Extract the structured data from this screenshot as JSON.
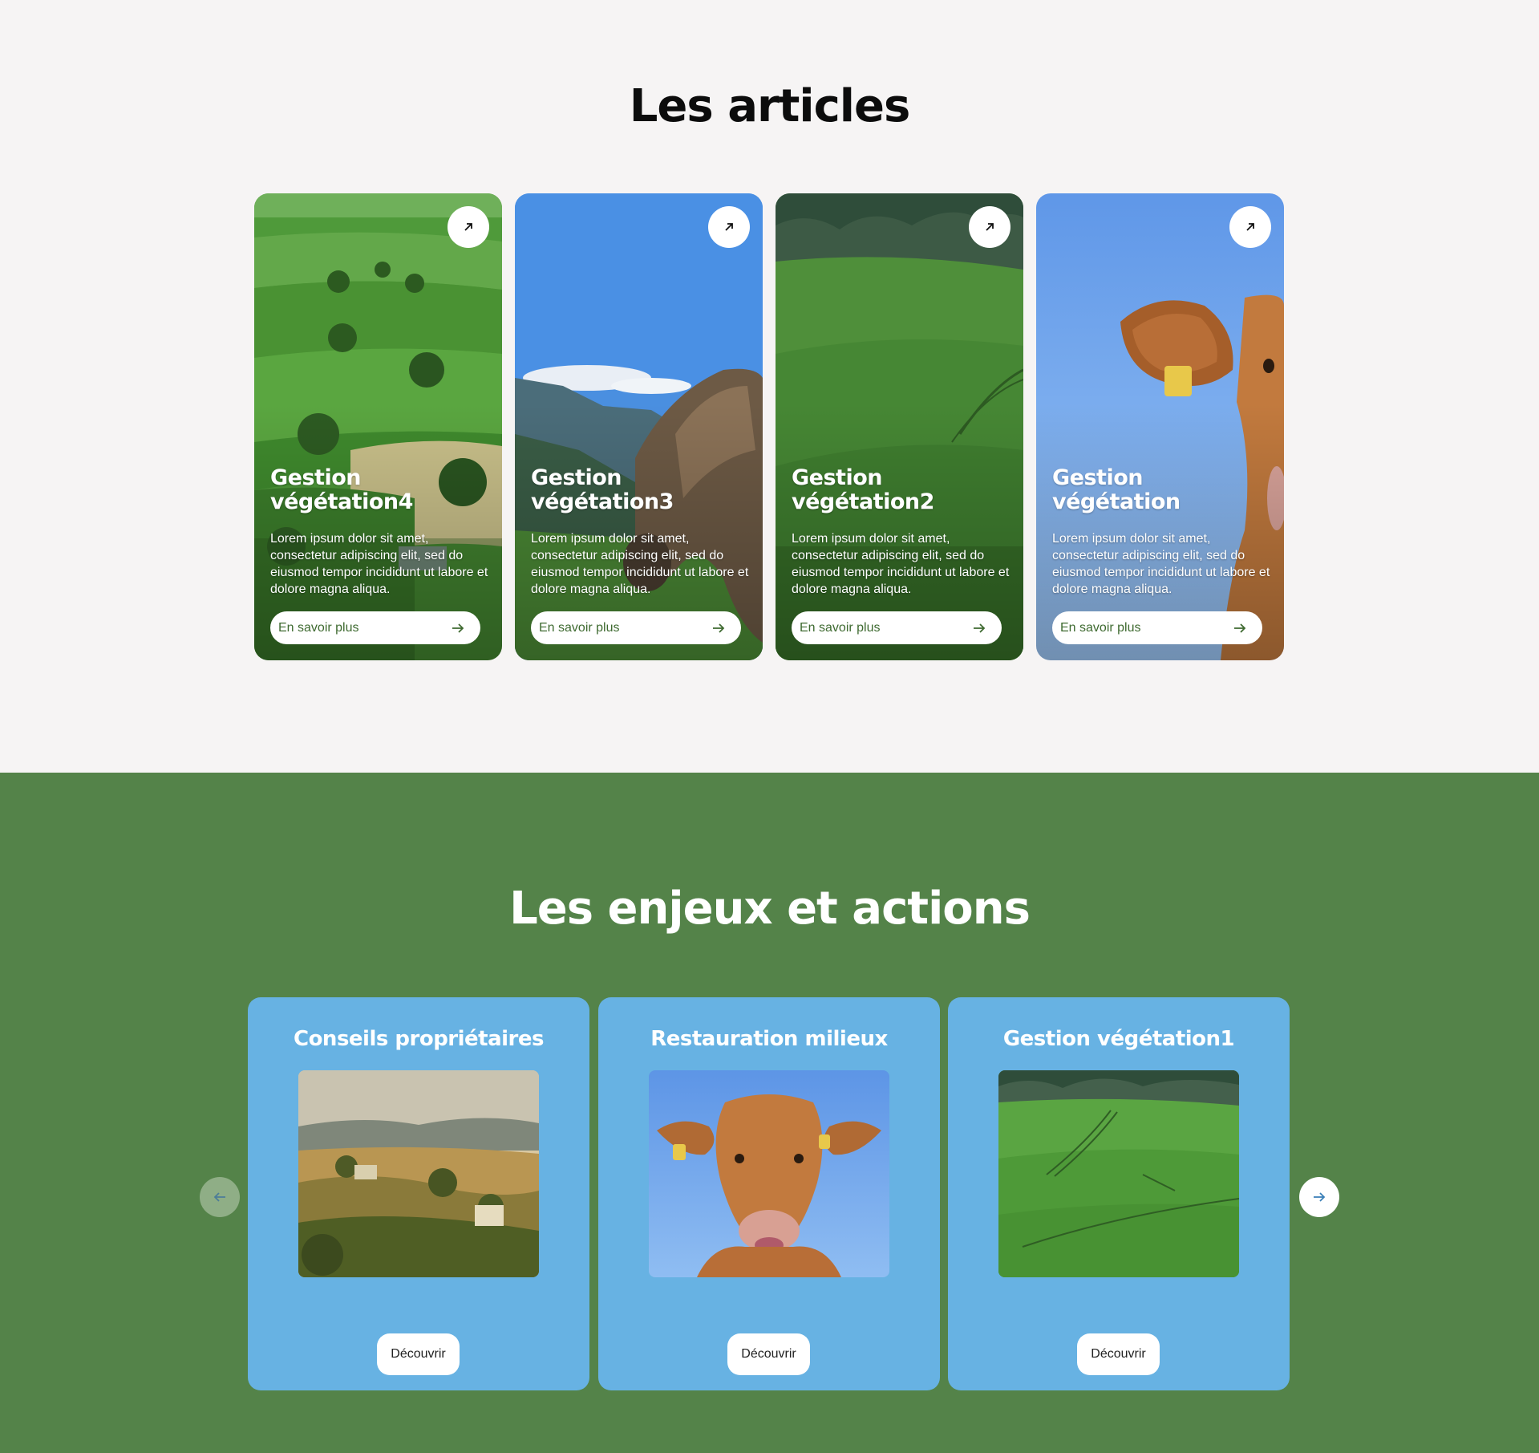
{
  "articles": {
    "heading": "Les articles",
    "cards": [
      {
        "title": "Gestion végétation4",
        "text": "Lorem ipsum dolor sit amet, consectetur adipiscing elit, sed do eiusmod tempor incididunt ut labore et dolore magna aliqua.",
        "button": "En savoir plus",
        "scene": "green-hills-village"
      },
      {
        "title": "Gestion végétation3",
        "text": "Lorem ipsum dolor sit amet, consectetur adipiscing elit, sed do eiusmod tempor incididunt ut labore et dolore magna aliqua.",
        "button": "En savoir plus",
        "scene": "cow-mountains"
      },
      {
        "title": "Gestion végétation2",
        "text": "Lorem ipsum dolor sit amet, consectetur adipiscing elit, sed do eiusmod tempor incididunt ut labore et dolore magna aliqua.",
        "button": "En savoir plus",
        "scene": "green-field"
      },
      {
        "title": "Gestion végétation",
        "text": "Lorem ipsum dolor sit amet, consectetur adipiscing elit, sed do eiusmod tempor incididunt ut labore et dolore magna aliqua.",
        "button": "En savoir plus",
        "scene": "cow-closeup"
      }
    ]
  },
  "enjeux": {
    "heading": "Les enjeux et actions",
    "cards": [
      {
        "title": "Conseils propriétaires",
        "button": "Découvrir",
        "scene": "tuscan-hills"
      },
      {
        "title": "Restauration milieux",
        "button": "Découvrir",
        "scene": "cow-portrait"
      },
      {
        "title": "Gestion végétation1",
        "button": "Découvrir",
        "scene": "green-field"
      }
    ]
  },
  "icons": {
    "corner": "arrow-up-right-icon",
    "more": "arrow-right-icon",
    "prev": "arrow-left-icon",
    "next": "arrow-right-icon"
  },
  "colors": {
    "page_bg": "#f6f4f4",
    "green_section": "#548349",
    "card_blue": "#67b2e3",
    "link_green": "#3e6a30"
  }
}
